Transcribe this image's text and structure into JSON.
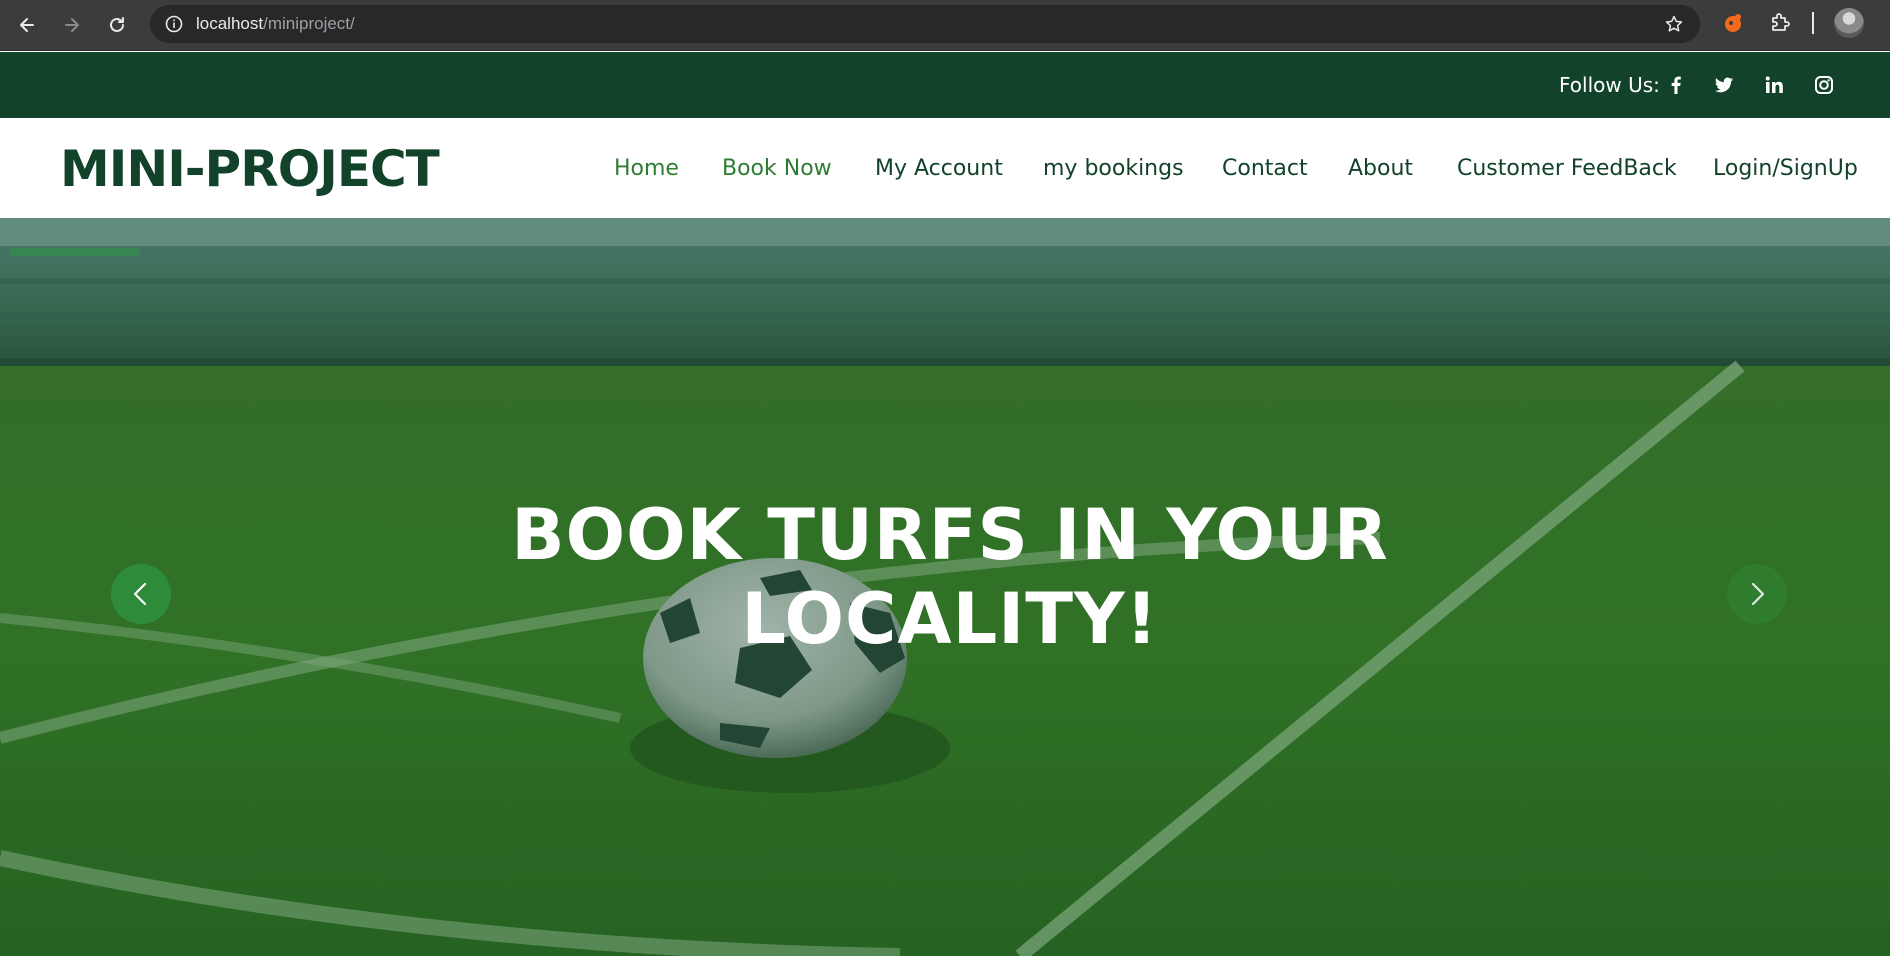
{
  "browser": {
    "url_host": "localhost",
    "url_path": "/miniproject/",
    "icons": [
      "back-icon",
      "forward-icon",
      "reload-icon",
      "site-info-icon",
      "bookmark-star-icon",
      "extension-icon",
      "puzzle-icon",
      "profile-avatar"
    ]
  },
  "topbar": {
    "follow_label": "Follow Us:",
    "socials": [
      "facebook-icon",
      "twitter-icon",
      "linkedin-icon",
      "instagram-icon"
    ],
    "background": "#12432a"
  },
  "header": {
    "logo": "MINI-PROJECT",
    "nav": [
      {
        "label": "Home",
        "active": true
      },
      {
        "label": "Book Now",
        "active": true
      },
      {
        "label": "My Account",
        "active": false
      },
      {
        "label": "my bookings",
        "active": false
      },
      {
        "label": "Contact",
        "active": false
      },
      {
        "label": "About",
        "active": false
      },
      {
        "label": "Customer FeedBack",
        "active": false
      },
      {
        "label": "Login/SignUp",
        "active": false
      }
    ],
    "accent": "#2e7d32",
    "text_color": "#12432a"
  },
  "hero": {
    "title_line1": "BOOK TURFS IN YOUR",
    "title_line2": "LOCALITY!",
    "prev_icon": "chevron-left-icon",
    "next_icon": "chevron-right-icon",
    "arrow_color": "#2e8b3a"
  }
}
